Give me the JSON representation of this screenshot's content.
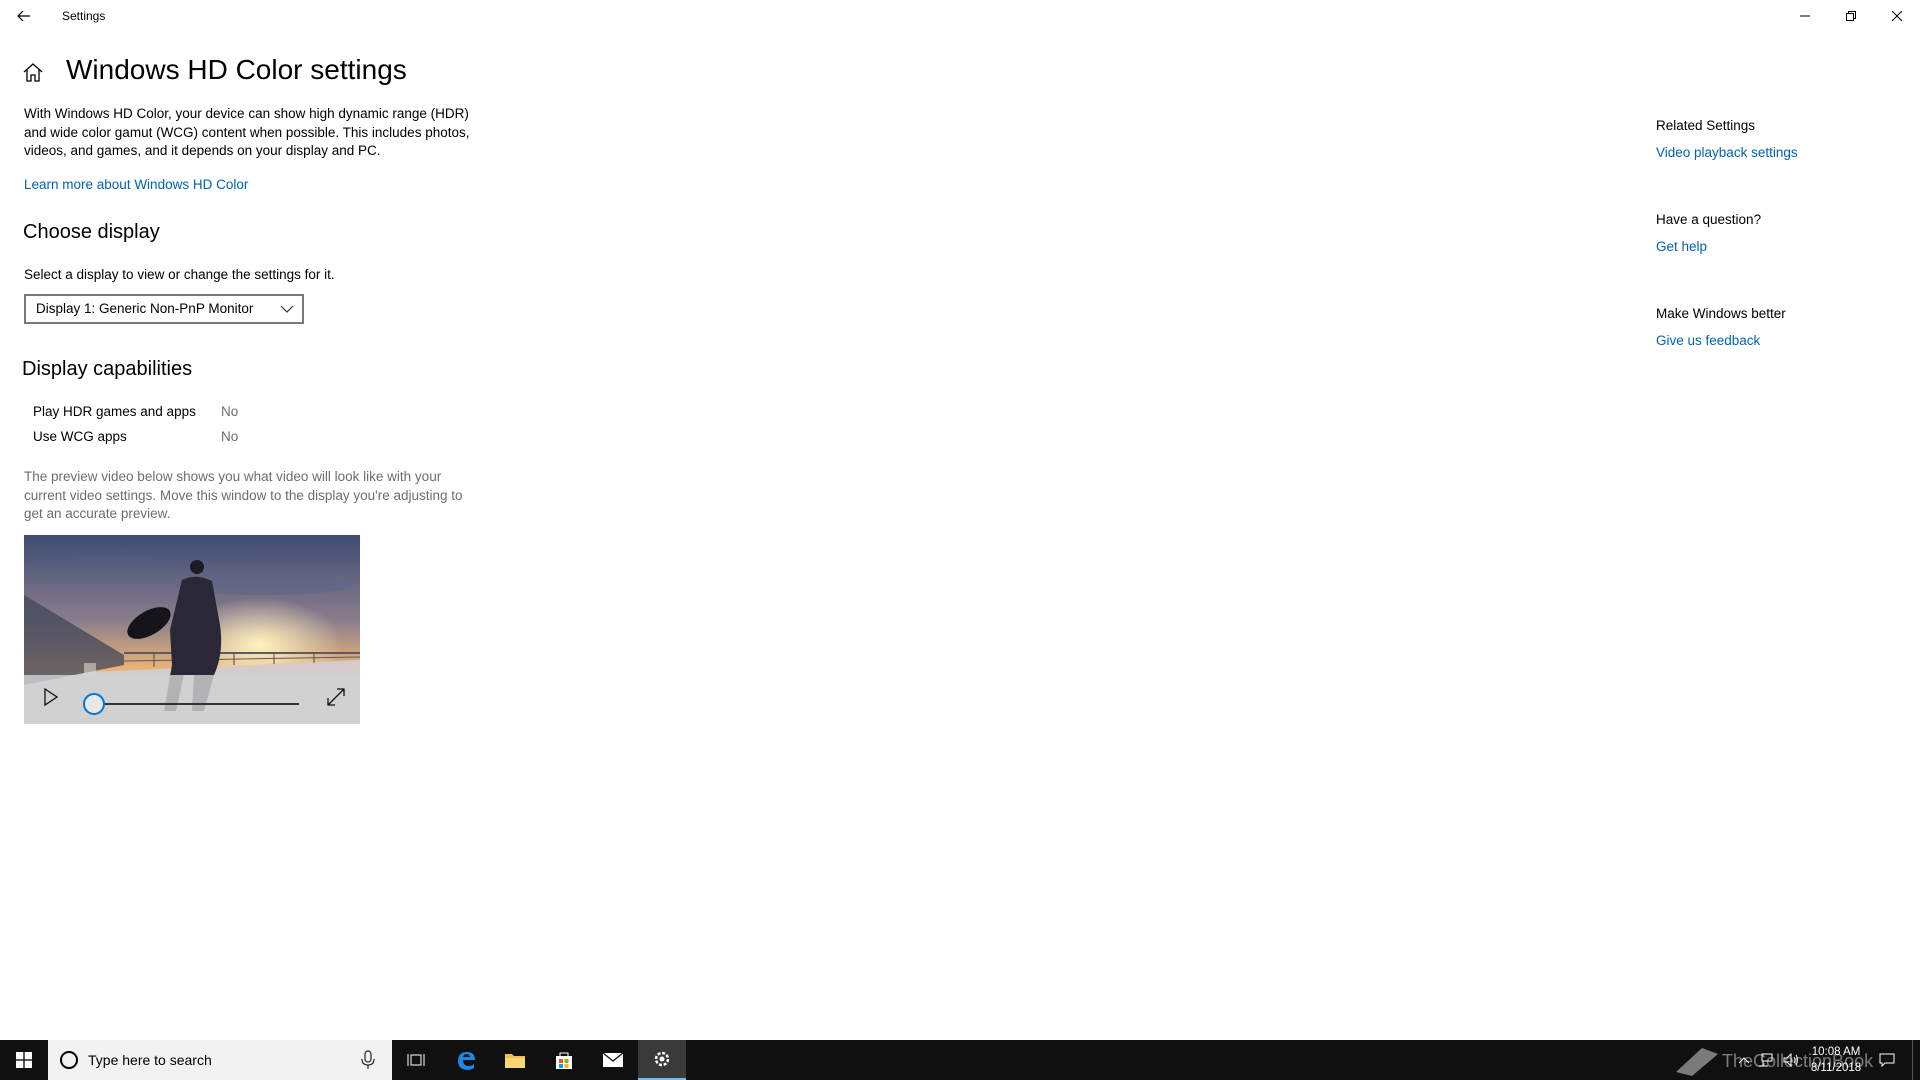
{
  "window": {
    "title": "Settings"
  },
  "page": {
    "title": "Windows HD Color settings",
    "description": "With Windows HD Color, your device can show high dynamic range (HDR) and wide color gamut (WCG) content when possible. This includes photos, videos, and games, and it depends on your display and PC.",
    "learn_more_link": "Learn more about Windows HD Color"
  },
  "choose_display": {
    "heading": "Choose display",
    "label": "Select a display to view or change the settings for it.",
    "selected_display": "Display 1: Generic Non-PnP Monitor"
  },
  "capabilities": {
    "heading": "Display capabilities",
    "rows": [
      {
        "label": "Play HDR games and apps",
        "value": "No"
      },
      {
        "label": "Use WCG apps",
        "value": "No"
      }
    ],
    "preview_note": "The preview video below shows you what video will look like with your current video settings. Move this window to the display you're adjusting to get an accurate preview."
  },
  "video": {
    "progress": 0
  },
  "related": {
    "related_heading": "Related Settings",
    "related_link": "Video playback settings",
    "question_heading": "Have a question?",
    "help_link": "Get help",
    "better_heading": "Make Windows better",
    "feedback_link": "Give us feedback"
  },
  "taskbar": {
    "search_placeholder": "Type here to search",
    "apps": [
      "task-view",
      "edge",
      "file-explorer",
      "store",
      "mail",
      "settings"
    ],
    "active_app": "settings",
    "time": "10:08 AM",
    "date": "8/11/2018",
    "watermark": "TheCollectionBook"
  },
  "colors": {
    "accent": "#0078d7",
    "link": "#0063b1",
    "taskbar": "#101010"
  }
}
